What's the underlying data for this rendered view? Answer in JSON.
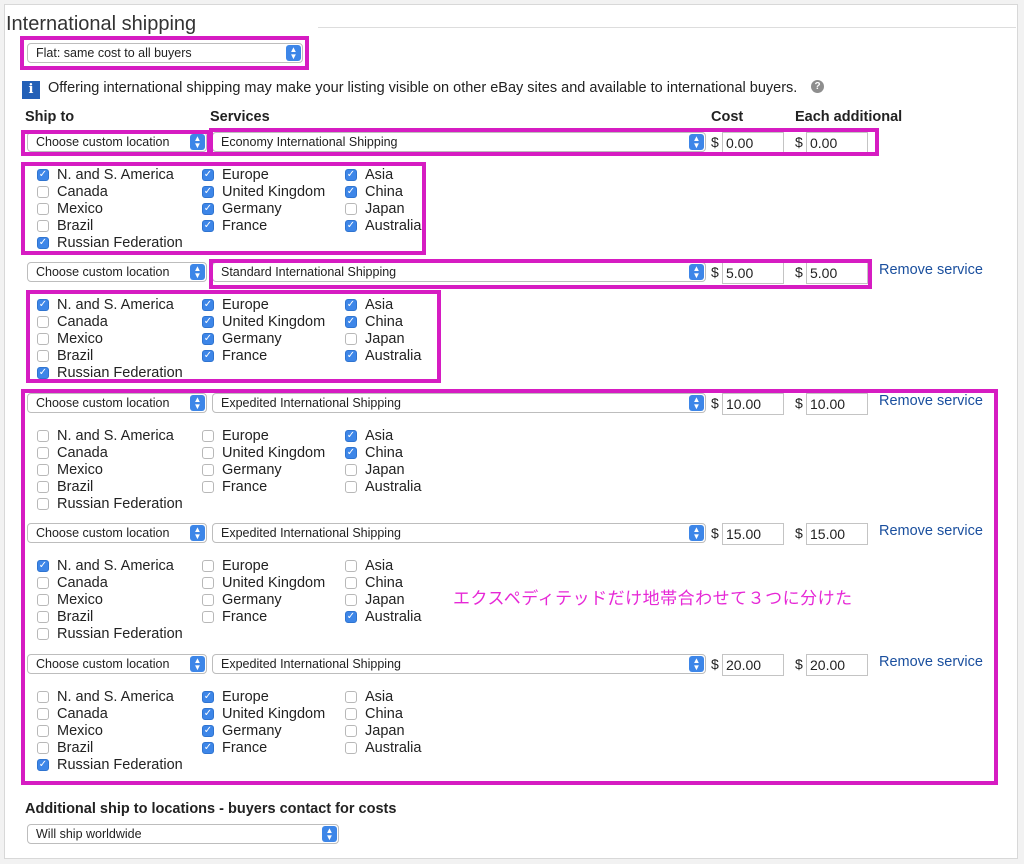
{
  "section_title": "International shipping",
  "shipping_type": "Flat: same cost to all buyers",
  "info_text": "Offering international shipping may make your listing visible on other eBay sites and available to international buyers.",
  "icons": {
    "info": "info-icon",
    "help": "help-icon",
    "dropdown": "chevron-updown-icon",
    "checkbox": "checkmark-icon"
  },
  "colors": {
    "accent": "#3d86e8",
    "annotation": "#d61cc2",
    "link": "#1a4f9e"
  },
  "headers": {
    "ship_to": "Ship to",
    "services": "Services",
    "cost": "Cost",
    "each_additional": "Each additional"
  },
  "currency_symbol": "$",
  "remove_label": "Remove service",
  "services": [
    {
      "location": "Choose custom location",
      "service": "Economy International Shipping",
      "cost": "0.00",
      "additional": "0.00",
      "has_remove": false,
      "checks": [
        true,
        false,
        false,
        false,
        true,
        true,
        true,
        true,
        true,
        true,
        true,
        false,
        true
      ]
    },
    {
      "location": "Choose custom location",
      "service": "Standard International Shipping",
      "cost": "5.00",
      "additional": "5.00",
      "has_remove": true,
      "checks": [
        true,
        false,
        false,
        false,
        true,
        true,
        true,
        true,
        true,
        true,
        true,
        false,
        true
      ]
    },
    {
      "location": "Choose custom location",
      "service": "Expedited International Shipping",
      "cost": "10.00",
      "additional": "10.00",
      "has_remove": true,
      "checks": [
        false,
        false,
        false,
        false,
        false,
        false,
        false,
        false,
        false,
        true,
        true,
        false,
        false
      ]
    },
    {
      "location": "Choose custom location",
      "service": "Expedited International Shipping",
      "cost": "15.00",
      "additional": "15.00",
      "has_remove": true,
      "checks": [
        true,
        false,
        false,
        false,
        false,
        false,
        false,
        false,
        false,
        false,
        false,
        false,
        true
      ]
    },
    {
      "location": "Choose custom location",
      "service": "Expedited International Shipping",
      "cost": "20.00",
      "additional": "20.00",
      "has_remove": true,
      "checks": [
        false,
        false,
        false,
        false,
        true,
        true,
        true,
        true,
        true,
        false,
        false,
        false,
        false
      ]
    }
  ],
  "regions": [
    "N. and S. America",
    "Canada",
    "Mexico",
    "Brazil",
    "Russian Federation",
    "Europe",
    "United Kingdom",
    "Germany",
    "France",
    "Asia",
    "China",
    "Japan",
    "Australia"
  ],
  "annotation_note": "エクスペディテッドだけ地帯合わせて３つに分けた",
  "additional_locations": {
    "label": "Additional ship to locations - buyers contact for costs",
    "value": "Will ship worldwide"
  }
}
